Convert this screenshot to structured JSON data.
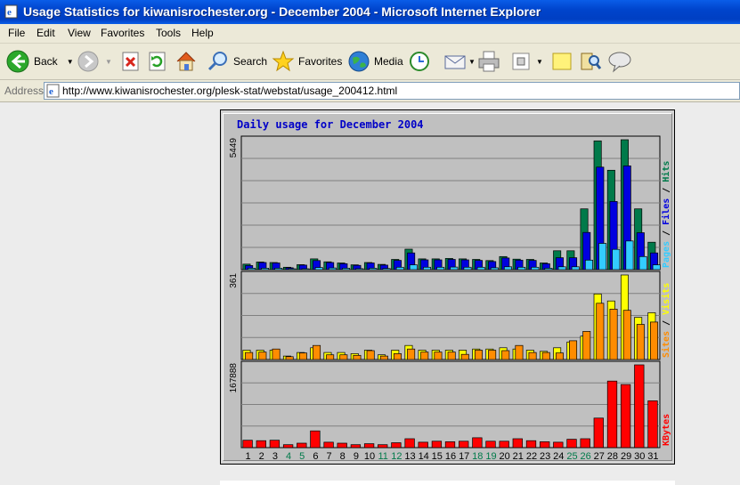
{
  "window": {
    "title": "Usage Statistics for kiwanisrochester.org - December 2004 - Microsoft Internet Explorer"
  },
  "menu": [
    "File",
    "Edit",
    "View",
    "Favorites",
    "Tools",
    "Help"
  ],
  "toolbar": {
    "back": "Back",
    "search": "Search",
    "favorites": "Favorites",
    "media": "Media"
  },
  "address": {
    "label": "Address",
    "url": "http://www.kiwanisrochester.org/plesk-stat/webstat/usage_200412.html"
  },
  "chart_data": {
    "type": "bar",
    "title": "Daily usage for December 2004",
    "categories": [
      "1",
      "2",
      "3",
      "4",
      "5",
      "6",
      "7",
      "8",
      "9",
      "10",
      "11",
      "12",
      "13",
      "14",
      "15",
      "16",
      "17",
      "18",
      "19",
      "20",
      "21",
      "22",
      "23",
      "24",
      "25",
      "26",
      "27",
      "28",
      "29",
      "30",
      "31"
    ],
    "weekend_days": [
      "4",
      "5",
      "11",
      "12",
      "18",
      "19",
      "25",
      "26"
    ],
    "panels": [
      {
        "name": "hits",
        "scale_label": "5449",
        "ymax": 5449,
        "legend": [
          "Pages",
          "/",
          "Files",
          "/",
          "Hits"
        ],
        "series": [
          {
            "name": "Hits",
            "color": "#007a4a",
            "values": [
              230,
              320,
              300,
              100,
              210,
              450,
              330,
              280,
              200,
              300,
              220,
              430,
              860,
              450,
              450,
              470,
              450,
              430,
              380,
              550,
              440,
              430,
              280,
              790,
              790,
              2550,
              5400,
              4170,
              5449,
              2550,
              1150
            ]
          },
          {
            "name": "Files",
            "color": "#0000e0",
            "values": [
              170,
              300,
              280,
              80,
              190,
              380,
              300,
              250,
              180,
              280,
              190,
              390,
              700,
              410,
              410,
              430,
              410,
              390,
              340,
              490,
              400,
              390,
              250,
              500,
              500,
              1560,
              4300,
              2860,
              4350,
              1550,
              700
            ]
          },
          {
            "name": "Pages",
            "color": "#33ccff",
            "values": [
              60,
              60,
              60,
              20,
              30,
              90,
              70,
              60,
              40,
              60,
              50,
              100,
              200,
              100,
              100,
              110,
              100,
              100,
              80,
              120,
              100,
              100,
              60,
              120,
              120,
              400,
              1100,
              850,
              1200,
              550,
              200
            ]
          }
        ]
      },
      {
        "name": "visits",
        "scale_label": "361",
        "ymax": 361,
        "legend": [
          "Sites",
          "/",
          "Visits"
        ],
        "series": [
          {
            "name": "Visits",
            "color": "#ffff00",
            "values": [
              40,
              40,
              40,
              15,
              30,
              50,
              30,
              30,
              25,
              40,
              20,
              40,
              60,
              40,
              40,
              40,
              40,
              45,
              45,
              50,
              45,
              40,
              35,
              50,
              75,
              100,
              280,
              250,
              361,
              180,
              200
            ]
          },
          {
            "name": "Sites",
            "color": "#ff8c00",
            "values": [
              30,
              32,
              45,
              12,
              28,
              60,
              20,
              20,
              18,
              38,
              15,
              25,
              45,
              32,
              32,
              32,
              22,
              40,
              40,
              38,
              60,
              30,
              30,
              28,
              80,
              120,
              240,
              215,
              210,
              150,
              160
            ]
          }
        ]
      },
      {
        "name": "kbytes",
        "scale_label": "167888",
        "ymax": 167888,
        "legend": [
          "KBytes"
        ],
        "series": [
          {
            "name": "KBytes",
            "color": "#ff0000",
            "values": [
              15000,
              14000,
              15000,
              6000,
              9000,
              34000,
              11000,
              9000,
              6000,
              8000,
              6000,
              10000,
              18000,
              11000,
              13000,
              12000,
              13000,
              20000,
              13000,
              13000,
              18000,
              14000,
              12000,
              11000,
              17000,
              18000,
              60000,
              135000,
              128000,
              167888,
              95000
            ]
          }
        ]
      }
    ]
  }
}
